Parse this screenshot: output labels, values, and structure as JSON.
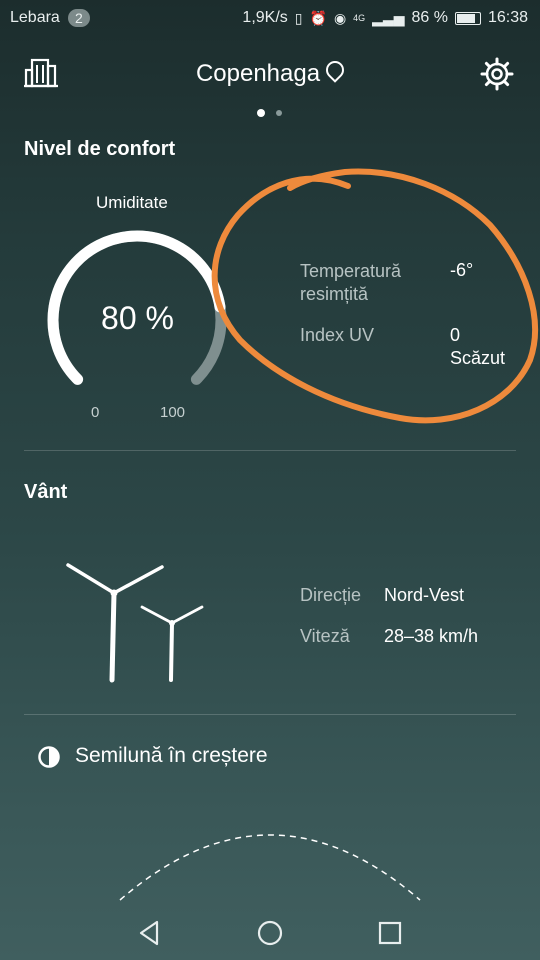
{
  "status_bar": {
    "carrier": "Lebara",
    "badge": "2",
    "speed": "1,9K/s",
    "net": "4G",
    "battery": "86 %",
    "time": "16:38"
  },
  "header": {
    "city": "Copenhaga",
    "page_index": 1,
    "page_count": 2
  },
  "comfort": {
    "title": "Nivel de confort",
    "humidity_label": "Umiditate",
    "humidity_value": "80 %",
    "humidity_fraction": 0.8,
    "scale_min": "0",
    "scale_max": "100",
    "feels_label": "Temperatură resimțită",
    "feels_value": "-6°",
    "uv_label": "Index UV",
    "uv_value": "0",
    "uv_level": "Scăzut"
  },
  "wind": {
    "title": "Vânt",
    "direction_label": "Direcție",
    "direction_value": "Nord-Vest",
    "speed_label": "Viteză",
    "speed_value": "28–38 km/h"
  },
  "moon": {
    "phase": "Semilună în creștere"
  },
  "colors": {
    "annotation": "#ee8a3c",
    "gauge_track": "#7f8f8f"
  }
}
